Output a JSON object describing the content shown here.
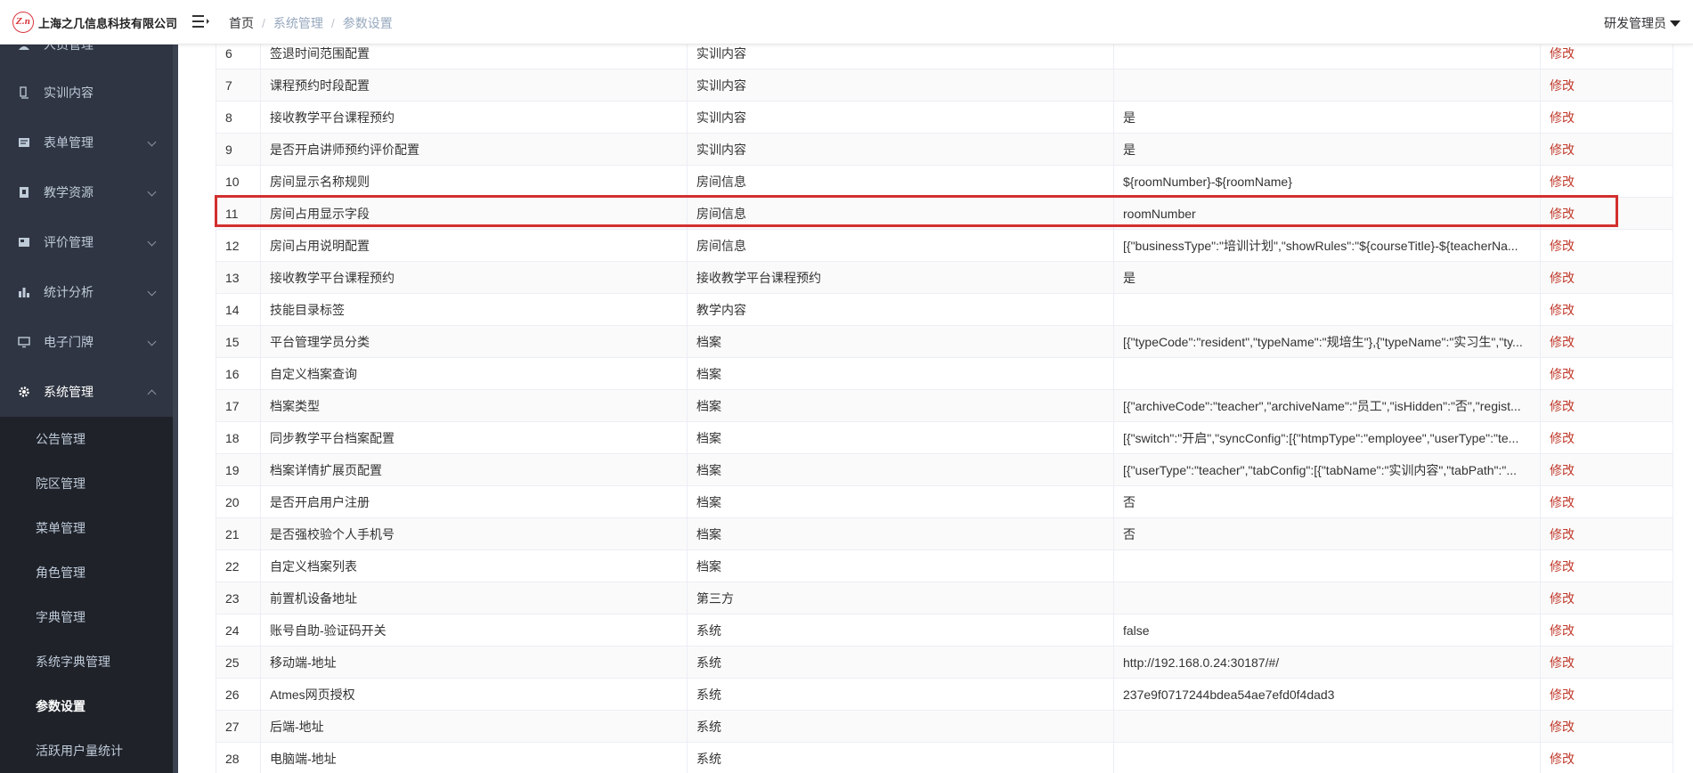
{
  "header": {
    "logo_mark": "Z.n",
    "company": "上海之几信息科技有限公司",
    "breadcrumb": [
      "首页",
      "系统管理",
      "参数设置"
    ],
    "breadcrumb_sep": "/",
    "user": "研发管理员"
  },
  "sidebar": {
    "items": [
      {
        "label": "人员管理",
        "icon": "user-icon"
      },
      {
        "label": "实训内容",
        "icon": "book-icon"
      },
      {
        "label": "表单管理",
        "icon": "form-icon"
      },
      {
        "label": "教学资源",
        "icon": "resource-icon"
      },
      {
        "label": "评价管理",
        "icon": "evaluate-icon"
      },
      {
        "label": "统计分析",
        "icon": "bar-chart-icon"
      },
      {
        "label": "电子门牌",
        "icon": "monitor-icon"
      },
      {
        "label": "系统管理",
        "icon": "gear-icon"
      }
    ],
    "subitems": [
      {
        "label": "公告管理"
      },
      {
        "label": "院区管理"
      },
      {
        "label": "菜单管理"
      },
      {
        "label": "角色管理"
      },
      {
        "label": "字典管理"
      },
      {
        "label": "系统字典管理"
      },
      {
        "label": "参数设置"
      },
      {
        "label": "活跃用户量统计"
      }
    ]
  },
  "table": {
    "edit_label": "修改",
    "rows": [
      {
        "no": "6",
        "name": "签退时间范围配置",
        "module": "实训内容",
        "value": ""
      },
      {
        "no": "7",
        "name": "课程预约时段配置",
        "module": "实训内容",
        "value": ""
      },
      {
        "no": "8",
        "name": "接收教学平台课程预约",
        "module": "实训内容",
        "value": "是"
      },
      {
        "no": "9",
        "name": "是否开启讲师预约评价配置",
        "module": "实训内容",
        "value": "是"
      },
      {
        "no": "10",
        "name": "房间显示名称规则",
        "module": "房间信息",
        "value": "${roomNumber}-${roomName}"
      },
      {
        "no": "11",
        "name": "房间占用显示字段",
        "module": "房间信息",
        "value": "roomNumber"
      },
      {
        "no": "12",
        "name": "房间占用说明配置",
        "module": "房间信息",
        "value": "[{\"businessType\":\"培训计划\",\"showRules\":\"${courseTitle}-${teacherNa..."
      },
      {
        "no": "13",
        "name": "接收教学平台课程预约",
        "module": "接收教学平台课程预约",
        "value": "是"
      },
      {
        "no": "14",
        "name": "技能目录标签",
        "module": "教学内容",
        "value": ""
      },
      {
        "no": "15",
        "name": "平台管理学员分类",
        "module": "档案",
        "value": "[{\"typeCode\":\"resident\",\"typeName\":\"规培生\"},{\"typeName\":\"实习生\",\"ty..."
      },
      {
        "no": "16",
        "name": "自定义档案查询",
        "module": "档案",
        "value": ""
      },
      {
        "no": "17",
        "name": "档案类型",
        "module": "档案",
        "value": "[{\"archiveCode\":\"teacher\",\"archiveName\":\"员工\",\"isHidden\":\"否\",\"regist..."
      },
      {
        "no": "18",
        "name": "同步教学平台档案配置",
        "module": "档案",
        "value": "[{\"switch\":\"开启\",\"syncConfig\":[{\"htmpType\":\"employee\",\"userType\":\"te..."
      },
      {
        "no": "19",
        "name": "档案详情扩展页配置",
        "module": "档案",
        "value": "[{\"userType\":\"teacher\",\"tabConfig\":[{\"tabName\":\"实训内容\",\"tabPath\":\"..."
      },
      {
        "no": "20",
        "name": "是否开启用户注册",
        "module": "档案",
        "value": "否"
      },
      {
        "no": "21",
        "name": "是否强校验个人手机号",
        "module": "档案",
        "value": "否"
      },
      {
        "no": "22",
        "name": "自定义档案列表",
        "module": "档案",
        "value": ""
      },
      {
        "no": "23",
        "name": "前置机设备地址",
        "module": "第三方",
        "value": ""
      },
      {
        "no": "24",
        "name": "账号自助-验证码开关",
        "module": "系统",
        "value": "false"
      },
      {
        "no": "25",
        "name": "移动端-地址",
        "module": "系统",
        "value": "http://192.168.0.24:30187/#/"
      },
      {
        "no": "26",
        "name": "Atmes网页授权",
        "module": "系统",
        "value": "237e9f0717244bdea54ae7efd0f4dad3"
      },
      {
        "no": "27",
        "name": "后端-地址",
        "module": "系统",
        "value": ""
      },
      {
        "no": "28",
        "name": "电脑端-地址",
        "module": "系统",
        "value": ""
      }
    ]
  },
  "colors": {
    "sidebar_bg": "#2f3542",
    "submenu_bg": "#1f2229",
    "edit_link": "#c0392b",
    "highlight": "#d32f2f"
  }
}
